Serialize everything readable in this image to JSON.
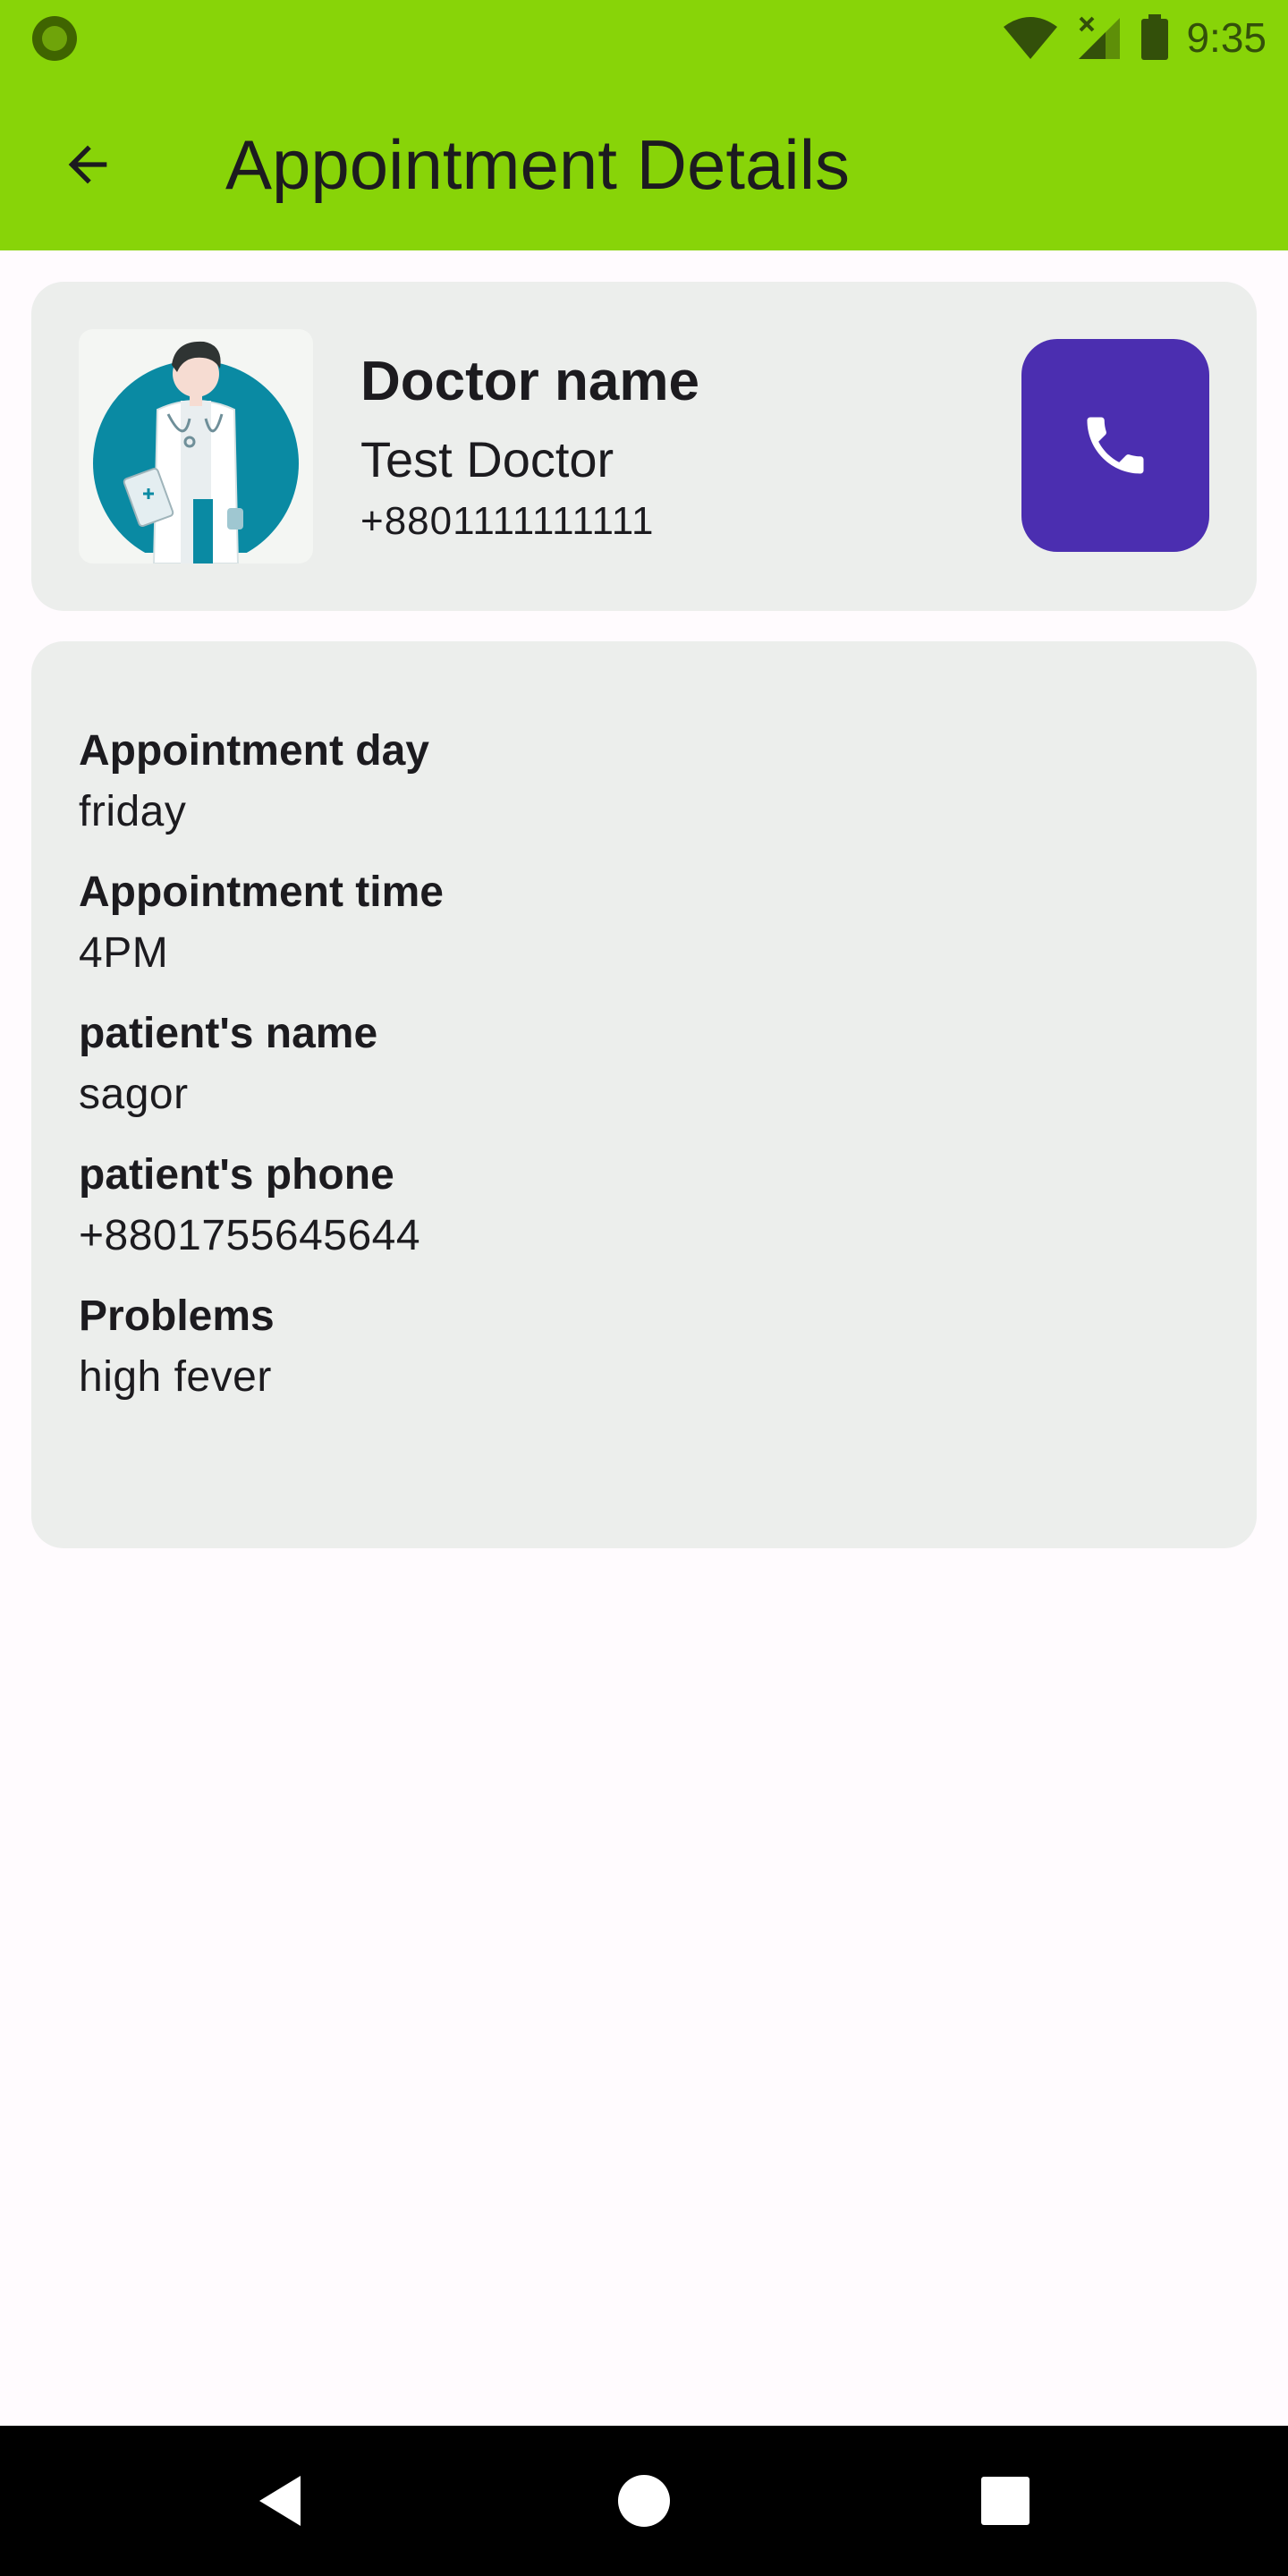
{
  "status_bar": {
    "time": "9:35"
  },
  "app_bar": {
    "title": "Appointment Details"
  },
  "doctor_card": {
    "label": "Doctor name",
    "name": "Test Doctor",
    "phone": "+8801111111111"
  },
  "details": [
    {
      "label": "Appointment day",
      "value": "friday"
    },
    {
      "label": "Appointment time",
      "value": "4PM"
    },
    {
      "label": "patient's name",
      "value": "sagor"
    },
    {
      "label": "patient's phone",
      "value": "+8801755645644"
    },
    {
      "label": "Problems",
      "value": "high fever"
    }
  ],
  "icons": {
    "back": "arrow-left-icon",
    "call": "phone-icon",
    "nav_back": "triangle-back-icon",
    "nav_home": "circle-home-icon",
    "nav_recents": "square-recents-icon"
  },
  "colors": {
    "app_bar": "#88d408",
    "call_button": "#4b2eb0",
    "card_background": "#eceeec"
  }
}
